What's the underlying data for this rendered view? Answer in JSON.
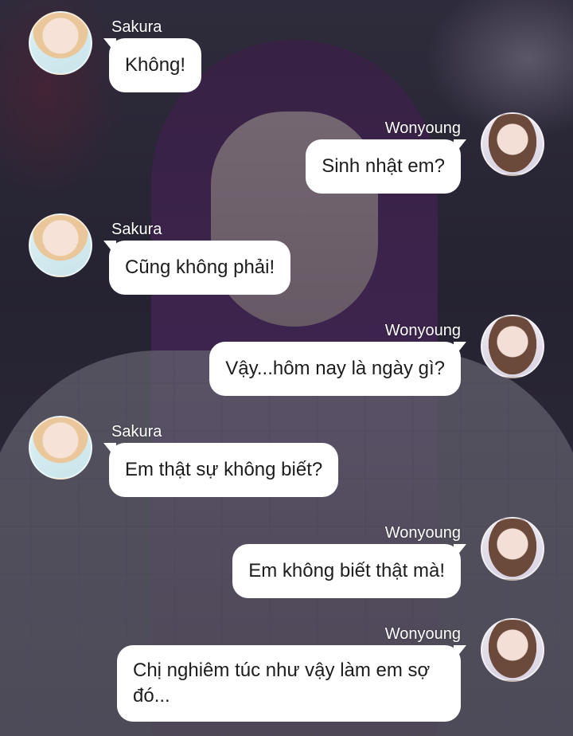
{
  "messages": [
    {
      "sender": "Sakura",
      "text": "Không!"
    },
    {
      "sender": "Wonyoung",
      "text": "Sinh nhật em?"
    },
    {
      "sender": "Sakura",
      "text": "Cũng không phải!"
    },
    {
      "sender": "Wonyoung",
      "text": "Vậy...hôm nay là ngày gì?"
    },
    {
      "sender": "Sakura",
      "text": "Em thật sự không biết?"
    },
    {
      "sender": "Wonyoung",
      "text": "Em không biết thật mà!"
    },
    {
      "sender": "Wonyoung",
      "text": "Chị nghiêm túc như vậy làm em sợ đó..."
    }
  ],
  "colors": {
    "bubble": "#ffffff",
    "text": "#1d1d1d",
    "name": "#ffffff"
  }
}
